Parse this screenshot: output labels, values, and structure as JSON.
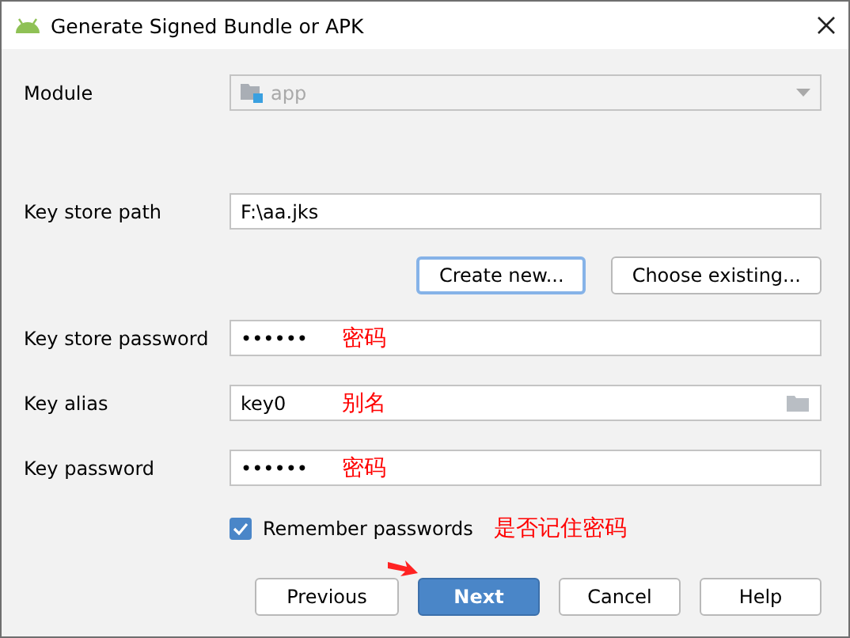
{
  "window": {
    "title": "Generate Signed Bundle or APK"
  },
  "module": {
    "label": "Module",
    "value": "app",
    "disabled": true
  },
  "fields": [
    {
      "kind": "text",
      "label": "Key store path",
      "value": "F:\\aa.jks"
    },
    {
      "kind": "buttons",
      "buttons": [
        {
          "label": "Create new...",
          "focused": true
        },
        {
          "label": "Choose existing...",
          "focused": false
        }
      ]
    },
    {
      "kind": "password",
      "label": "Key store password",
      "value": "••••••",
      "note": "密码"
    },
    {
      "kind": "browse",
      "label": "Key alias",
      "value": "key0",
      "note": "别名"
    },
    {
      "kind": "password",
      "label": "Key password",
      "value": "••••••",
      "note": "密码"
    }
  ],
  "remember": {
    "label": "Remember passwords",
    "checked": true,
    "note": "是否记住密码"
  },
  "buttons": [
    {
      "label": "Previous",
      "primary": false,
      "pointed": false
    },
    {
      "label": "Next",
      "primary": true,
      "pointed": true
    },
    {
      "label": "Cancel",
      "primary": false,
      "pointed": false
    },
    {
      "label": "Help",
      "primary": false,
      "pointed": false
    }
  ]
}
